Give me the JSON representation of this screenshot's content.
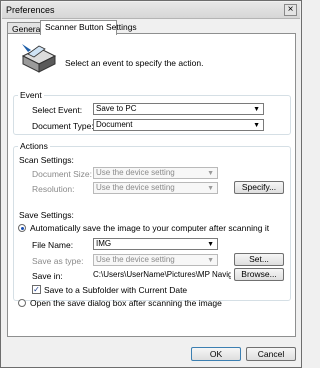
{
  "window": {
    "title": "Preferences",
    "close_glyph": "×"
  },
  "tabs": [
    {
      "label": "General"
    },
    {
      "label": "Scanner Button Settings"
    }
  ],
  "header": {
    "instruction": "Select an event to specify the action."
  },
  "event": {
    "group_label": "Event",
    "select_event_label": "Select Event:",
    "select_event_value": "Save to PC",
    "document_type_label": "Document Type:",
    "document_type_value": "Document"
  },
  "actions": {
    "group_label": "Actions",
    "scan_settings_label": "Scan Settings:",
    "document_size_label": "Document Size:",
    "document_size_value": "Use the device setting",
    "resolution_label": "Resolution:",
    "resolution_value": "Use the device setting",
    "specify_button": "Specify...",
    "save_settings_label": "Save Settings:",
    "auto_save_label": "Automatically save the image to your computer after scanning it",
    "file_name_label": "File Name:",
    "file_name_value": "IMG",
    "save_as_type_label": "Save as type:",
    "save_as_type_value": "Use the device setting",
    "set_button": "Set...",
    "save_in_label": "Save in:",
    "save_in_value": "C:\\Users\\UserName\\Pictures\\MP Navigat",
    "browse_button": "Browse...",
    "subfolder_label": "Save to a Subfolder with Current Date",
    "open_dialog_label": "Open the save dialog box after scanning the image"
  },
  "footer": {
    "ok_button": "OK",
    "cancel_button": "Cancel"
  }
}
